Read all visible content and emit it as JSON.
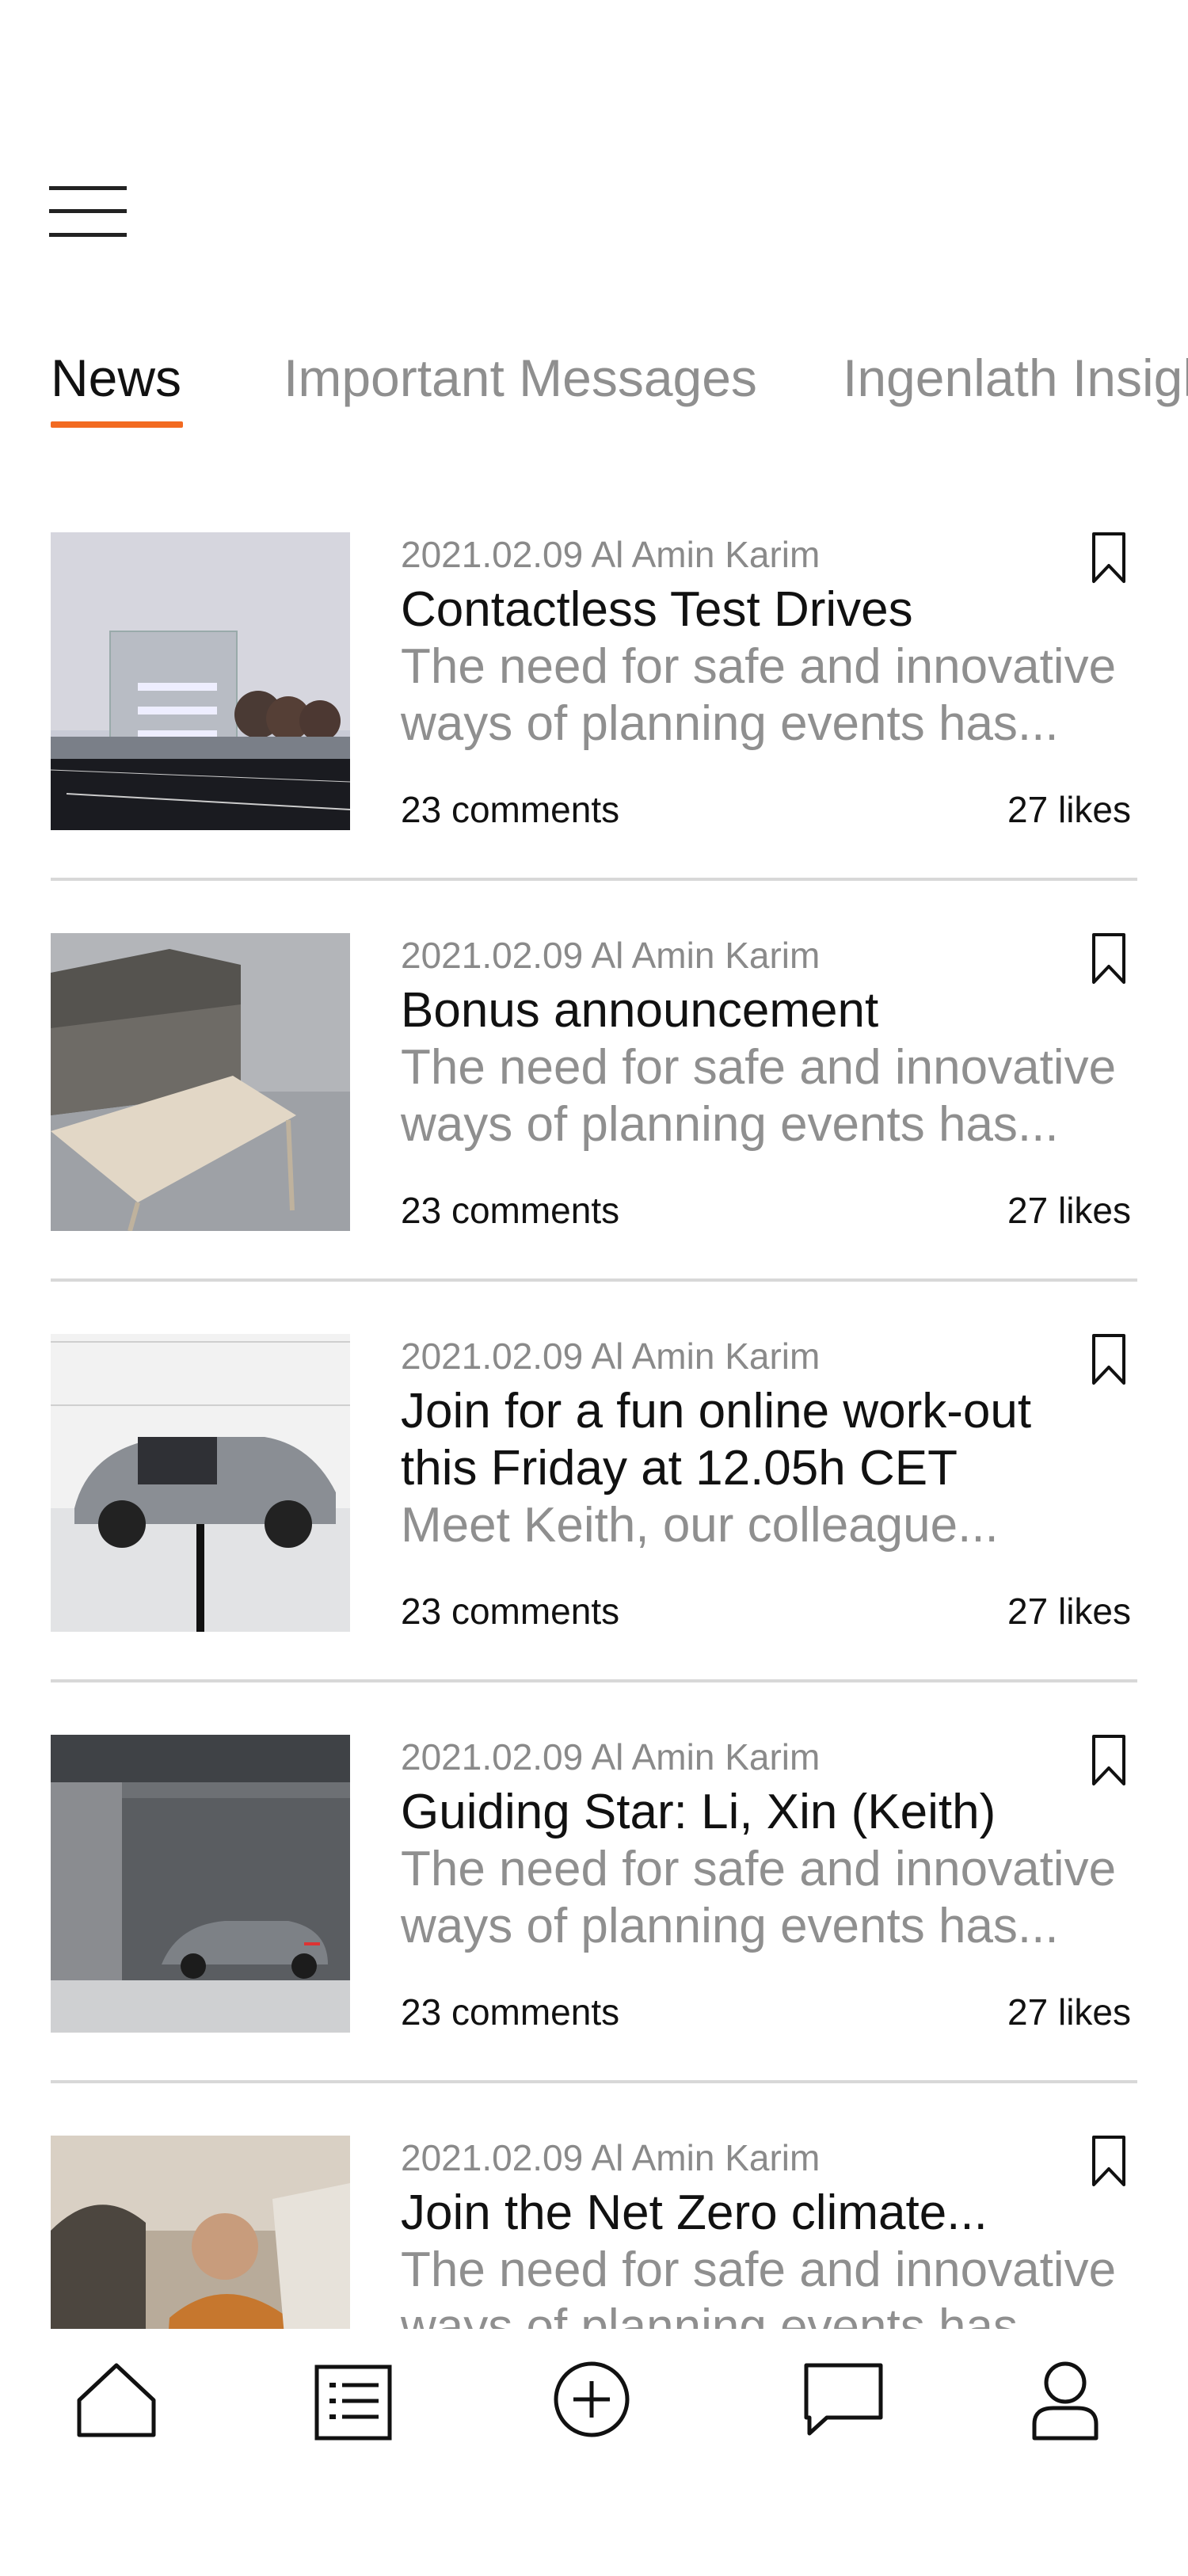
{
  "tabs": [
    {
      "label": "News",
      "active": true
    },
    {
      "label": "Important Messages",
      "active": false
    },
    {
      "label": "Ingenlath Insights",
      "active": false
    }
  ],
  "accent_color": "#f26a21",
  "articles": [
    {
      "meta": "2021.02.09 Al Amin Karim",
      "title": "Contactless Test Drives",
      "excerpt": "The need for safe and innovative ways of planning events has...",
      "comments": "23 comments",
      "likes": "27 likes",
      "image": "modern-building-photo"
    },
    {
      "meta": "2021.02.09 Al Amin Karim",
      "title": "Bonus announcement",
      "excerpt": "The need for safe and innovative ways of planning events has...",
      "comments": "23 comments",
      "likes": "27 likes",
      "image": "sofa-and-table-photo"
    },
    {
      "meta": "2021.02.09 Al Amin Karim",
      "title": "Join for a fun online work-out this Friday at 12.05h CET",
      "excerpt": "Meet Keith, our colleague...",
      "comments": "23 comments",
      "likes": "27 likes",
      "image": "concept-car-photo"
    },
    {
      "meta": "2021.02.09 Al Amin Karim",
      "title": "Guiding Star: Li, Xin (Keith)",
      "excerpt": "The need for safe and innovative ways of planning events has...",
      "comments": "23 comments",
      "likes": "27 likes",
      "image": "car-in-garage-photo"
    },
    {
      "meta": "2021.02.09 Al Amin Karim",
      "title": "Join the Net Zero climate...",
      "excerpt": "The need for safe and innovative ways of planning events has...",
      "comments": "23 comments",
      "likes": "27 likes",
      "image": "man-in-car-photo"
    }
  ],
  "bottom_nav": [
    {
      "icon": "home-icon"
    },
    {
      "icon": "list-icon"
    },
    {
      "icon": "add-circle-icon"
    },
    {
      "icon": "chat-bubble-icon"
    },
    {
      "icon": "profile-icon"
    }
  ]
}
